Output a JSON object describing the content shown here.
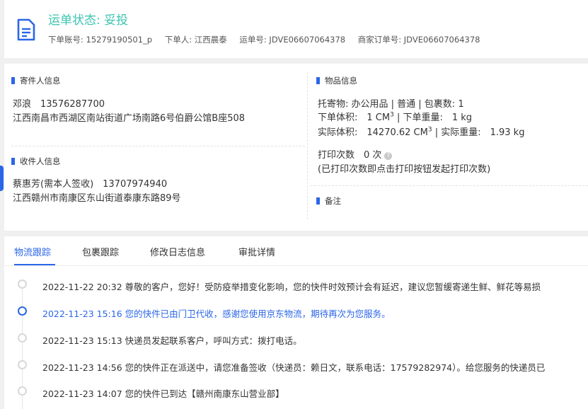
{
  "header": {
    "status_title": "运单状态: 妥投",
    "account_label": "下单账号: 15279190501_p",
    "orderer_label": "下单人: 江西晨泰",
    "waybill_label": "运单号: JDVE06607064378",
    "merchant_label": "商家订单号: JDVE06607064378"
  },
  "sender": {
    "title": "寄件人信息",
    "name_phone": "邓浪　13576287700",
    "address": "江西南昌市西湖区南站街道广场南路6号伯爵公馆B座508"
  },
  "receiver": {
    "title": "收件人信息",
    "name_phone": "蔡惠芳(需本人签收)　13707974940",
    "address": "江西赣州市南康区东山街道泰康东路89号"
  },
  "goods": {
    "title": "物品信息",
    "line1": "托寄物: 办公用品 | 普通 | 包裹数: 1",
    "vol_label": "下单体积:　1 CM",
    "vol_sup": "3",
    "weight_label": " | 下单重量:　1 kg",
    "actual_vol_label": "实际体积:　14270.62 CM",
    "actual_vol_sup": "3",
    "actual_weight_label": " | 实际重量:　1.93 kg",
    "print_count": "打印次数　0 次",
    "print_note": "(已打印次数即点击打印按钮发起打印次数)"
  },
  "remark": {
    "title": "备注"
  },
  "tabs": [
    {
      "label": "物流跟踪"
    },
    {
      "label": "包裹跟踪"
    },
    {
      "label": "修改日志信息"
    },
    {
      "label": "审批详情"
    }
  ],
  "events": [
    {
      "text": "2022-11-22 20:32  尊敬的客户，您好！受防疫举措变化影响，您的快件时效预计会有延迟，建议您暂缓寄递生鲜、鲜花等易损"
    },
    {
      "text": "2022-11-23 15:16  您的快件已由门卫代收，感谢您使用京东物流，期待再次为您服务。"
    },
    {
      "text": "2022-11-23 15:13  快递员发起联系客户，呼叫方式：拨打电话。"
    },
    {
      "text": "2022-11-23 14:56  您的快件正在派送中，请您准备签收（快递员：赖日文，联系电话：17579282974）。给您服务的快递员已"
    },
    {
      "text": "2022-11-23 14:07  您的快件已到达【赣州南康东山营业部】"
    }
  ],
  "colors": {
    "accent": "#2b66e8",
    "status": "#3bc4b0"
  }
}
